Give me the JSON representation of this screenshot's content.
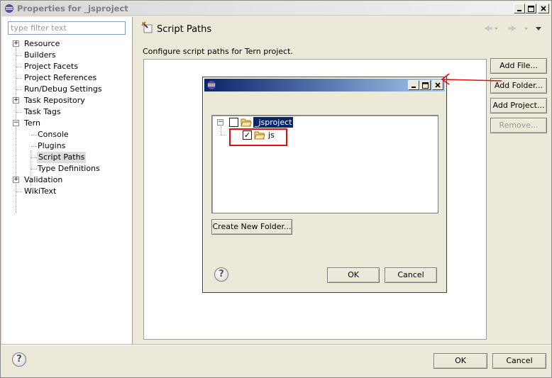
{
  "window": {
    "title": "Properties for _jsproject"
  },
  "left": {
    "filter_placeholder": "type filter text",
    "tree": [
      {
        "label": "Resource",
        "expander": "+"
      },
      {
        "label": "Builders"
      },
      {
        "label": "Project Facets"
      },
      {
        "label": "Project References"
      },
      {
        "label": "Run/Debug Settings"
      },
      {
        "label": "Task Repository",
        "expander": "+"
      },
      {
        "label": "Task Tags"
      },
      {
        "label": "Tern",
        "expander": "−"
      },
      {
        "label": "Console"
      },
      {
        "label": "Plugins"
      },
      {
        "label": "Script Paths"
      },
      {
        "label": "Type Definitions"
      },
      {
        "label": "Validation",
        "expander": "+"
      },
      {
        "label": "WikiText"
      }
    ]
  },
  "page": {
    "title": "Script Paths",
    "description": "Configure script paths for Tern project.",
    "buttons": {
      "add_file": "Add File...",
      "add_folder": "Add Folder...",
      "add_project": "Add Project...",
      "remove": "Remove..."
    }
  },
  "dialog": {
    "tree": {
      "root_label": "_jsproject",
      "root_expander": "−",
      "child_label": "js"
    },
    "create_folder_label": "Create New Folder...",
    "ok_label": "OK",
    "cancel_label": "Cancel"
  },
  "footer": {
    "ok_label": "OK",
    "cancel_label": "Cancel"
  },
  "colors": {
    "annotation": "#e01010",
    "dialog_title_start": "#0a246a",
    "dialog_title_end": "#a6caf0",
    "tree_selection": "#0a246a"
  },
  "icons": {
    "window": "eclipse-icon",
    "page": "script-paths-icon",
    "help": "help-icon",
    "folder": "folder-icon"
  }
}
